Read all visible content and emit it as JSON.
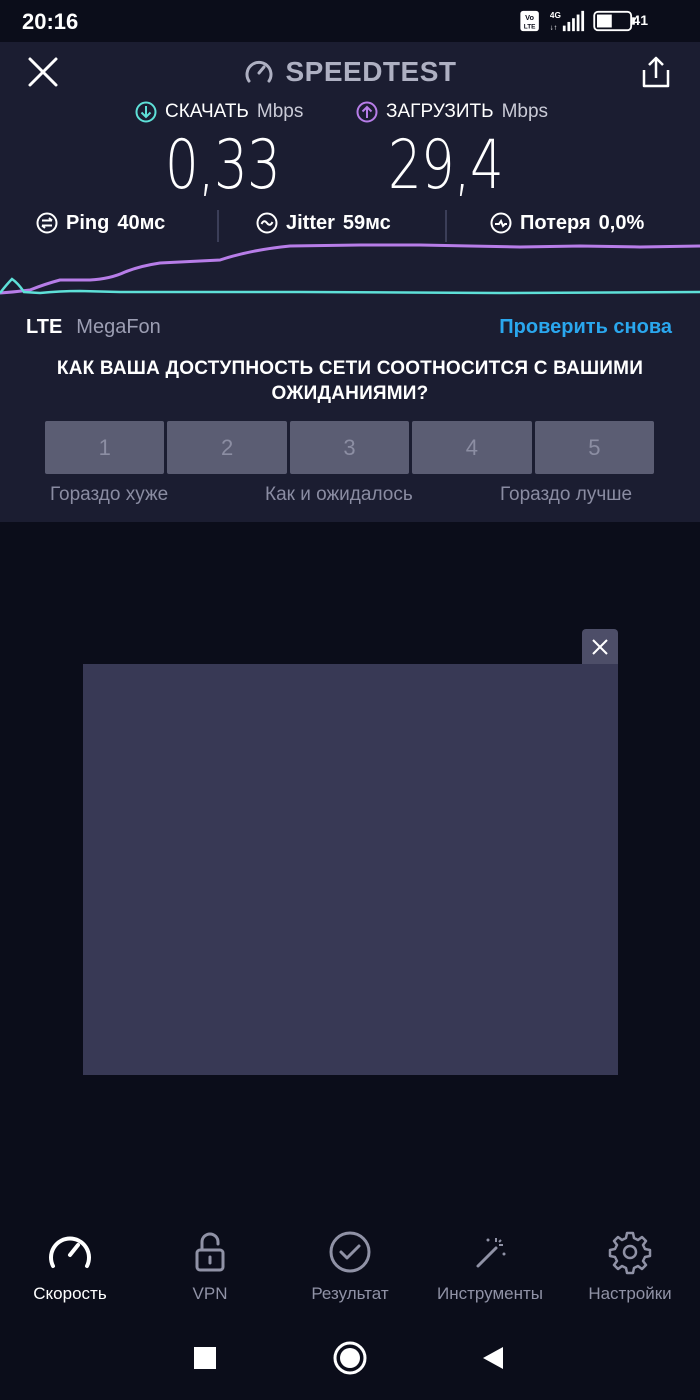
{
  "status_bar": {
    "time": "20:16",
    "network": "4G",
    "volte": "Vo LTE",
    "battery": "41"
  },
  "header": {
    "title": "SPEEDTEST"
  },
  "download": {
    "label": "СКАЧАТЬ",
    "unit": "Mbps",
    "value": "0,33",
    "color": "#5ee0d8"
  },
  "upload": {
    "label": "ЗАГРУЗИТЬ",
    "unit": "Mbps",
    "value": "29,4",
    "color": "#b77de8"
  },
  "stats": {
    "ping_label": "Ping",
    "ping_value": "40мс",
    "jitter_label": "Jitter",
    "jitter_value": "59мс",
    "loss_label": "Потеря",
    "loss_value": "0,0%"
  },
  "connection": {
    "type": "LTE",
    "carrier": "MegaFon",
    "retest_label": "Проверить снова"
  },
  "survey": {
    "question": "КАК ВАША ДОСТУПНОСТЬ СЕТИ СООТНОСИТСЯ С ВАШИМИ ОЖИДАНИЯМИ?",
    "options": [
      "1",
      "2",
      "3",
      "4",
      "5"
    ],
    "label_low": "Гораздо хуже",
    "label_mid": "Как и ожидалось",
    "label_high": "Гораздо лучше"
  },
  "bottom_nav": {
    "items": [
      {
        "label": "Скорость",
        "icon": "speedometer-icon",
        "active": true
      },
      {
        "label": "VPN",
        "icon": "unlock-icon",
        "active": false
      },
      {
        "label": "Результат",
        "icon": "check-circle-icon",
        "active": false
      },
      {
        "label": "Инструменты",
        "icon": "magic-wand-icon",
        "active": false
      },
      {
        "label": "Настройки",
        "icon": "gear-icon",
        "active": false
      }
    ]
  },
  "colors": {
    "accent_blue": "#2aa7ee",
    "background": "#0b0d1a",
    "panel": "#1b1d31"
  }
}
